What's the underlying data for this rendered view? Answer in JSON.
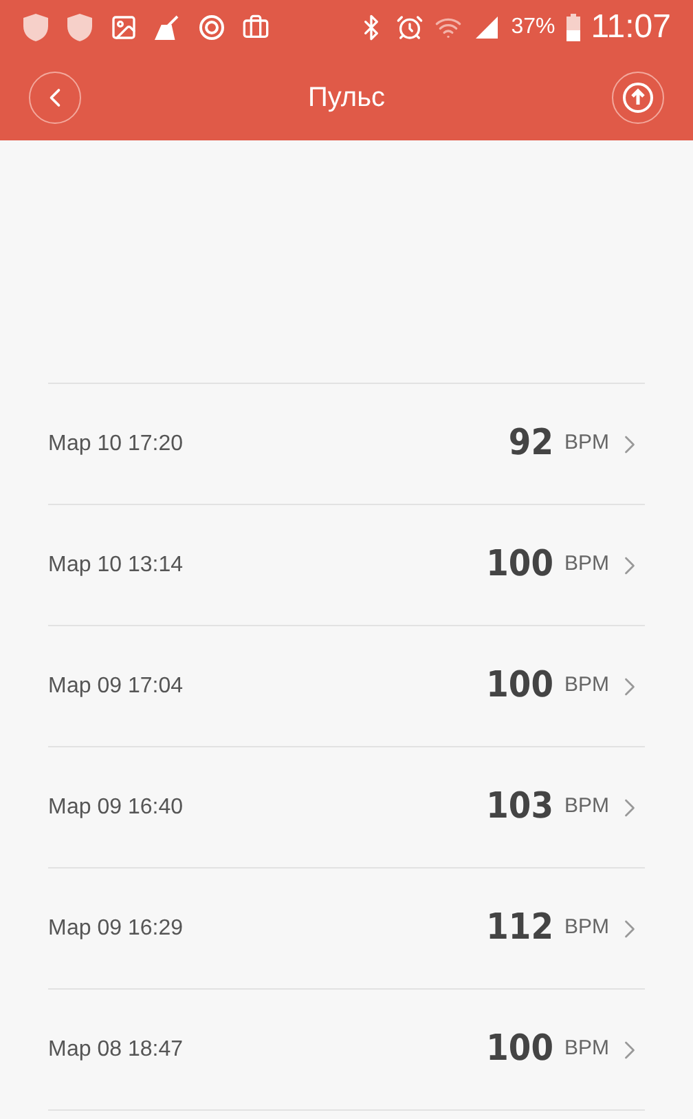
{
  "status_bar": {
    "battery": "37%",
    "time": "11:07"
  },
  "header": {
    "title": "Пульс"
  },
  "records": [
    {
      "time": "Мар 10 17:20",
      "value": "92",
      "unit": "BPM"
    },
    {
      "time": "Мар 10 13:14",
      "value": "100",
      "unit": "BPM"
    },
    {
      "time": "Мар 09 17:04",
      "value": "100",
      "unit": "BPM"
    },
    {
      "time": "Мар 09 16:40",
      "value": "103",
      "unit": "BPM"
    },
    {
      "time": "Мар 09 16:29",
      "value": "112",
      "unit": "BPM"
    },
    {
      "time": "Мар 08 18:47",
      "value": "100",
      "unit": "BPM"
    }
  ]
}
